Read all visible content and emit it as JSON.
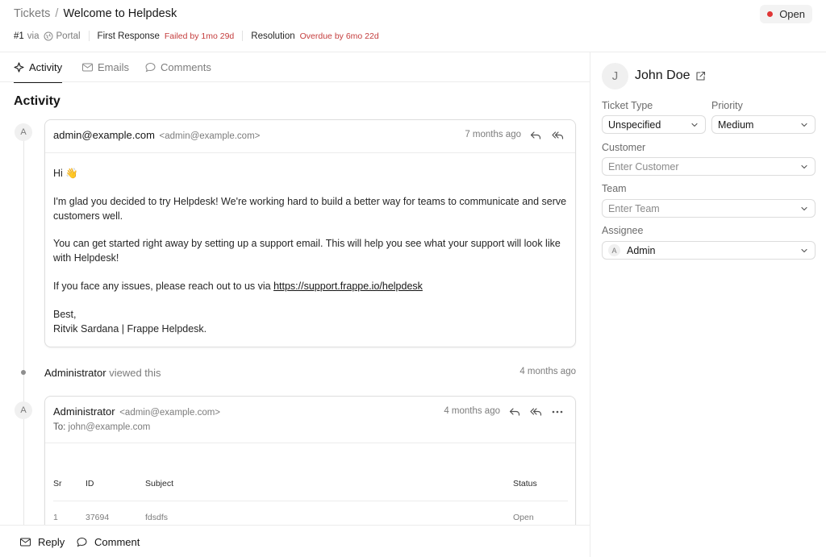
{
  "header": {
    "breadcrumb_parent": "Tickets",
    "breadcrumb_separator": "/",
    "title": "Welcome to Helpdesk",
    "status": "Open",
    "status_color": "#e03636",
    "ticket_id": "#1",
    "via_label": "via",
    "channel": "Portal",
    "first_response_label": "First Response",
    "first_response_status": "Failed by 1mo 29d",
    "resolution_label": "Resolution",
    "resolution_status": "Overdue by 6mo 22d"
  },
  "tabs": [
    {
      "label": "Activity",
      "icon": "activity-icon",
      "active": true
    },
    {
      "label": "Emails",
      "icon": "mail-icon",
      "active": false
    },
    {
      "label": "Comments",
      "icon": "comment-icon",
      "active": false
    }
  ],
  "activity": {
    "title": "Activity",
    "email1": {
      "avatar": "A",
      "sender": "admin@example.com",
      "sender_email": "<admin@example.com>",
      "time": "7 months ago",
      "body": {
        "greeting": "Hi 👋",
        "p1": "I'm glad you decided to try Helpdesk! We're working hard to build a better way for teams to communicate and serve customers well.",
        "p2": "You can get started right away by setting up a support email. This will help you see what your support will look like with Helpdesk!",
        "p3_prefix": "If you face any issues, please reach out to us via ",
        "p3_link": "https://support.frappe.io/helpdesk",
        "sign1": "Best,",
        "sign2": "Ritvik Sardana | Frappe Helpdesk."
      }
    },
    "view_event": {
      "actor": "Administrator",
      "action": "viewed this",
      "time": "4 months ago"
    },
    "email2": {
      "avatar": "A",
      "sender": "Administrator",
      "sender_email": "<admin@example.com>",
      "time": "4 months ago",
      "to_label": "To:",
      "to_value": "john@example.com",
      "table": {
        "headers": [
          "Sr",
          "ID",
          "Subject",
          "Status"
        ],
        "rows": [
          [
            "1",
            "37694",
            "fdsdfs",
            "Open"
          ]
        ]
      }
    }
  },
  "footer": {
    "reply_label": "Reply",
    "comment_label": "Comment"
  },
  "sidebar": {
    "contact_initial": "J",
    "contact_name": "John Doe",
    "ticket_type_label": "Ticket Type",
    "ticket_type_value": "Unspecified",
    "priority_label": "Priority",
    "priority_value": "Medium",
    "customer_label": "Customer",
    "customer_placeholder": "Enter Customer",
    "team_label": "Team",
    "team_placeholder": "Enter Team",
    "assignee_label": "Assignee",
    "assignee_initial": "A",
    "assignee_value": "Admin"
  }
}
